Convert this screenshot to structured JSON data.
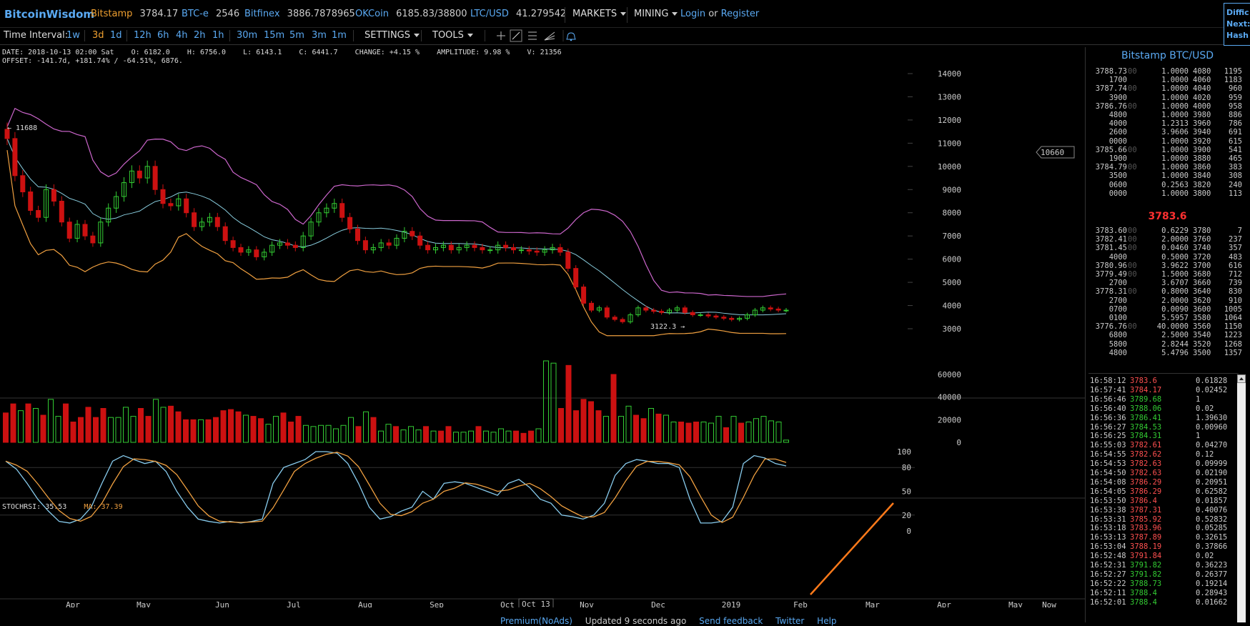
{
  "brand": "BitcoinWisdom",
  "tickers": [
    {
      "name": "Bitstamp",
      "value": "3784.17"
    },
    {
      "name": "BTC-e",
      "value": "2546"
    },
    {
      "name": "Bitfinex",
      "value": "3886.7878965"
    },
    {
      "name": "OKCoin",
      "value": "6185.83/38800"
    },
    {
      "name": "LTC/USD",
      "value": "41.279542"
    }
  ],
  "menus": {
    "markets": "MARKETS",
    "mining": "MINING",
    "login": "Login",
    "or": "or",
    "register": "Register"
  },
  "corner": {
    "line1": "Diffic",
    "line2": "Next:",
    "line3": "Hash"
  },
  "toolbar": {
    "time_interval_label": "Time Interval:",
    "intervals": [
      "1w",
      "3d",
      "1d",
      "12h",
      "6h",
      "4h",
      "2h",
      "1h",
      "30m",
      "15m",
      "5m",
      "3m",
      "1m"
    ],
    "active_interval": "3d",
    "settings": "SETTINGS",
    "tools": "TOOLS"
  },
  "info": {
    "line1": "DATE: 2018-10-13 02:00 Sat    O: 6182.0    H: 6756.0    L: 6143.1    C: 6441.7    CHANGE: +4.15 %    AMPLITUDE: 9.98 %    V: 21356",
    "line2": "OFFSET: -141.7d, +181.74% / -64.51%, 6876."
  },
  "chart": {
    "high_label": "← 11688",
    "low_label": "3122.3 →",
    "cursor_price": "10660",
    "cursor_date": "Oct 13",
    "price_ticks": [
      "14000",
      "13000",
      "12000",
      "11000",
      "10000",
      "9000",
      "8000",
      "7000",
      "6000",
      "5000",
      "4000",
      "3000"
    ],
    "volume_ticks": [
      "60000",
      "40000",
      "20000",
      "0"
    ],
    "stoch_ticks": [
      "100",
      "80",
      "50",
      "20",
      "0"
    ],
    "months": [
      "Apr",
      "May",
      "Jun",
      "Jul",
      "Aug",
      "Sep",
      "Oct",
      "Nov",
      "Dec",
      "2019",
      "Feb",
      "Mar",
      "Apr",
      "May",
      "Now"
    ],
    "stoch_label": "STOCHRSI: 35.53",
    "ma_label": "MA: 37.39",
    "colors": {
      "up": "#33cc33",
      "down": "#cc1111",
      "upper_band": "#cc66cc",
      "lower_band": "#f0a040",
      "mid_band": "#88ccdd",
      "stoch": "#88ccee",
      "ma": "#f0a040",
      "trend": "#ff7a1a"
    }
  },
  "chart_data": {
    "type": "candlestick",
    "ylim": [
      2500,
      14500
    ],
    "close": [
      11200,
      9600,
      8900,
      8100,
      7800,
      9000,
      8500,
      7600,
      6900,
      7500,
      7000,
      6700,
      7600,
      8200,
      8700,
      9300,
      9800,
      9500,
      10000,
      9000,
      8400,
      8300,
      8600,
      8000,
      7400,
      7600,
      7800,
      7400,
      6800,
      6500,
      6300,
      6400,
      6100,
      6300,
      6600,
      6700,
      6600,
      6500,
      7000,
      7600,
      8000,
      8200,
      8400,
      7800,
      7300,
      6800,
      6400,
      6500,
      6700,
      6600,
      6900,
      7200,
      7000,
      6600,
      6400,
      6500,
      6600,
      6400,
      6500,
      6600,
      6500,
      6400,
      6400,
      6600,
      6500,
      6400,
      6400,
      6350,
      6300,
      6400,
      6500,
      6300,
      5600,
      4800,
      4100,
      3800,
      3900,
      3500,
      3400,
      3300,
      3600,
      3900,
      3800,
      3750,
      3700,
      3800,
      3900,
      3700,
      3600,
      3600,
      3550,
      3500,
      3450,
      3400,
      3450,
      3600,
      3800,
      3900,
      3850,
      3800,
      3800
    ],
    "volume": [
      26000,
      34000,
      28000,
      34000,
      30000,
      24000,
      38000,
      23000,
      34000,
      18000,
      22000,
      31000,
      22000,
      30000,
      22000,
      22000,
      31000,
      23000,
      30000,
      23000,
      38000,
      31000,
      32000,
      27000,
      20000,
      20000,
      20000,
      20000,
      22000,
      28000,
      29000,
      27000,
      24000,
      23000,
      21000,
      16000,
      23000,
      26000,
      18000,
      23000,
      15000,
      14000,
      15000,
      15000,
      12000,
      15000,
      22000,
      14000,
      27000,
      22000,
      10000,
      16000,
      14000,
      11000,
      14000,
      11000,
      14000,
      10000,
      10000,
      14000,
      9000,
      9000,
      10000,
      14000,
      10000,
      9000,
      12000,
      10000,
      10000,
      8000,
      10000,
      12000,
      72000,
      70000,
      30000,
      68000,
      28000,
      38000,
      36000,
      28000,
      23000,
      60000,
      23000,
      32000,
      24000,
      21000,
      30000,
      25000,
      24000,
      18000,
      18000,
      17000,
      18000,
      18000,
      17000,
      23000,
      13000,
      23000,
      17000,
      18000,
      21000,
      23000,
      19000,
      18000,
      2000
    ],
    "volume_up_mask": "0010101100000011110011000010000010011000111111101011011101001110111100011100000010110010110001110101111110",
    "stochrsi": [
      88,
      78,
      60,
      40,
      25,
      12,
      10,
      15,
      30,
      60,
      88,
      95,
      90,
      85,
      88,
      75,
      50,
      30,
      15,
      12,
      10,
      12,
      10,
      12,
      15,
      60,
      80,
      85,
      90,
      100,
      100,
      98,
      85,
      60,
      30,
      15,
      18,
      25,
      30,
      50,
      40,
      60,
      62,
      60,
      55,
      50,
      45,
      60,
      65,
      55,
      40,
      35,
      20,
      18,
      15,
      20,
      35,
      70,
      85,
      90,
      88,
      85,
      85,
      80,
      40,
      10,
      10,
      12,
      30,
      85,
      95,
      92,
      85,
      82
    ]
  },
  "orderbook": {
    "title": "Bitstamp BTC/USD",
    "mid_price": "3783.6",
    "asks": [
      [
        "3788.73",
        "00",
        "1.0000",
        "4080",
        "1195"
      ],
      [
        "1700",
        "",
        "1.0000",
        "4060",
        "1183"
      ],
      [
        "3787.74",
        "00",
        "1.0000",
        "4040",
        "960"
      ],
      [
        "3900",
        "",
        "1.0000",
        "4020",
        "959"
      ],
      [
        "3786.76",
        "00",
        "1.0000",
        "4000",
        "958"
      ],
      [
        "4800",
        "",
        "1.0000",
        "3980",
        "886"
      ],
      [
        "4000",
        "",
        "1.2313",
        "3960",
        "786"
      ],
      [
        "2600",
        "",
        "3.9606",
        "3940",
        "691"
      ],
      [
        "0000",
        "",
        "1.0000",
        "3920",
        "615"
      ],
      [
        "3785.66",
        "00",
        "1.0000",
        "3900",
        "541"
      ],
      [
        "1900",
        "",
        "1.0000",
        "3880",
        "465"
      ],
      [
        "3784.79",
        "00",
        "1.0000",
        "3860",
        "383"
      ],
      [
        "3500",
        "",
        "1.0000",
        "3840",
        "308"
      ],
      [
        "0600",
        "",
        "0.2563",
        "3820",
        "240"
      ],
      [
        "0000",
        "",
        "1.0000",
        "3800",
        "113"
      ]
    ],
    "bids": [
      [
        "3783.60",
        "00",
        "0.6229",
        "3780",
        "7"
      ],
      [
        "3782.41",
        "00",
        "2.0000",
        "3760",
        "237"
      ],
      [
        "3781.45",
        "00",
        "0.0460",
        "3740",
        "357"
      ],
      [
        "4000",
        "",
        "0.5000",
        "3720",
        "483"
      ],
      [
        "3780.96",
        "00",
        "3.9622",
        "3700",
        "616"
      ],
      [
        "3779.49",
        "00",
        "1.5000",
        "3680",
        "712"
      ],
      [
        "2700",
        "",
        "3.6707",
        "3660",
        "739"
      ],
      [
        "3778.31",
        "00",
        "0.8000",
        "3640",
        "830"
      ],
      [
        "2700",
        "",
        "2.0000",
        "3620",
        "910"
      ],
      [
        "0700",
        "",
        "0.0090",
        "3600",
        "1005"
      ],
      [
        "0100",
        "",
        "5.5957",
        "3580",
        "1064"
      ],
      [
        "3776.76",
        "00",
        "40.0000",
        "3560",
        "1150"
      ],
      [
        "6800",
        "",
        "2.5000",
        "3540",
        "1223"
      ],
      [
        "5800",
        "",
        "2.8244",
        "3520",
        "1268"
      ],
      [
        "4800",
        "",
        "5.4796",
        "3500",
        "1357"
      ]
    ]
  },
  "trades": [
    {
      "time": "16:58:12",
      "price": "3783.6",
      "amount": "0.61828",
      "dir": "down"
    },
    {
      "time": "16:57:41",
      "price": "3784.17",
      "amount": "0.02452",
      "dir": "down"
    },
    {
      "time": "16:56:46",
      "price": "3789.68",
      "amount": "1",
      "dir": "up"
    },
    {
      "time": "16:56:40",
      "price": "3788.06",
      "amount": "0.02",
      "dir": "up"
    },
    {
      "time": "16:56:36",
      "price": "3786.41",
      "amount": "1.39630",
      "dir": "up"
    },
    {
      "time": "16:56:27",
      "price": "3784.53",
      "amount": "0.00960",
      "dir": "up"
    },
    {
      "time": "16:56:25",
      "price": "3784.31",
      "amount": "1",
      "dir": "up"
    },
    {
      "time": "16:55:03",
      "price": "3782.61",
      "amount": "0.04270",
      "dir": "down"
    },
    {
      "time": "16:54:55",
      "price": "3782.62",
      "amount": "0.12",
      "dir": "down"
    },
    {
      "time": "16:54:53",
      "price": "3782.63",
      "amount": "0.09999",
      "dir": "down"
    },
    {
      "time": "16:54:50",
      "price": "3782.63",
      "amount": "0.02190",
      "dir": "down"
    },
    {
      "time": "16:54:08",
      "price": "3786.29",
      "amount": "0.20951",
      "dir": "down"
    },
    {
      "time": "16:54:05",
      "price": "3786.29",
      "amount": "0.62582",
      "dir": "down"
    },
    {
      "time": "16:53:50",
      "price": "3786.4",
      "amount": "0.01857",
      "dir": "down"
    },
    {
      "time": "16:53:38",
      "price": "3787.31",
      "amount": "0.40076",
      "dir": "down"
    },
    {
      "time": "16:53:31",
      "price": "3785.92",
      "amount": "0.52832",
      "dir": "down"
    },
    {
      "time": "16:53:18",
      "price": "3783.96",
      "amount": "0.05285",
      "dir": "down"
    },
    {
      "time": "16:53:13",
      "price": "3787.89",
      "amount": "0.32615",
      "dir": "down"
    },
    {
      "time": "16:53:04",
      "price": "3788.19",
      "amount": "0.37866",
      "dir": "down"
    },
    {
      "time": "16:52:48",
      "price": "3791.84",
      "amount": "0.02",
      "dir": "down"
    },
    {
      "time": "16:52:31",
      "price": "3791.82",
      "amount": "0.36223",
      "dir": "up"
    },
    {
      "time": "16:52:27",
      "price": "3791.82",
      "amount": "0.26377",
      "dir": "up"
    },
    {
      "time": "16:52:22",
      "price": "3788.73",
      "amount": "0.19214",
      "dir": "up"
    },
    {
      "time": "16:52:11",
      "price": "3788.4",
      "amount": "0.28943",
      "dir": "up"
    },
    {
      "time": "16:52:01",
      "price": "3788.4",
      "amount": "0.01662",
      "dir": "up"
    }
  ],
  "footer": {
    "premium": "Premium(NoAds)",
    "updated": "Updated 9 seconds ago",
    "feedback": "Send feedback",
    "twitter": "Twitter",
    "help": "Help"
  }
}
